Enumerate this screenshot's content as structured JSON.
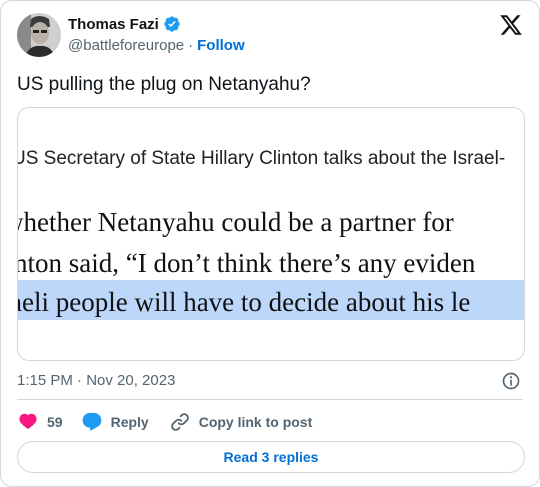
{
  "author": {
    "display_name": "Thomas Fazi",
    "handle": "@battleforeurope",
    "separator": "·",
    "follow_label": "Follow"
  },
  "tweet": {
    "text": "US pulling the plug on Netanyahu?",
    "timestamp": "1:15 PM · Nov 20, 2023"
  },
  "media": {
    "caption": "US Secretary of State Hillary Clinton talks about the Israel-",
    "lines": [
      "whether Netanyahu could be a partner for",
      "nton said, “I don’t think there’s any eviden",
      "aeli people will have to decide about his le"
    ],
    "highlight_color": "#bcd7fa"
  },
  "actions": {
    "like_count": "59",
    "reply_label": "Reply",
    "copy_label": "Copy link to post"
  },
  "footer": {
    "read_replies_label": "Read 3 replies"
  },
  "icons": {
    "verified": "verified-badge-icon",
    "logo": "x-logo-icon",
    "info": "info-icon",
    "like": "heart-icon",
    "reply": "speech-bubble-icon",
    "copy": "link-icon"
  },
  "colors": {
    "accent": "#006fd6",
    "like": "#f91880",
    "reply": "#1d9bf0",
    "muted": "#536471",
    "border": "#cfd9de"
  }
}
